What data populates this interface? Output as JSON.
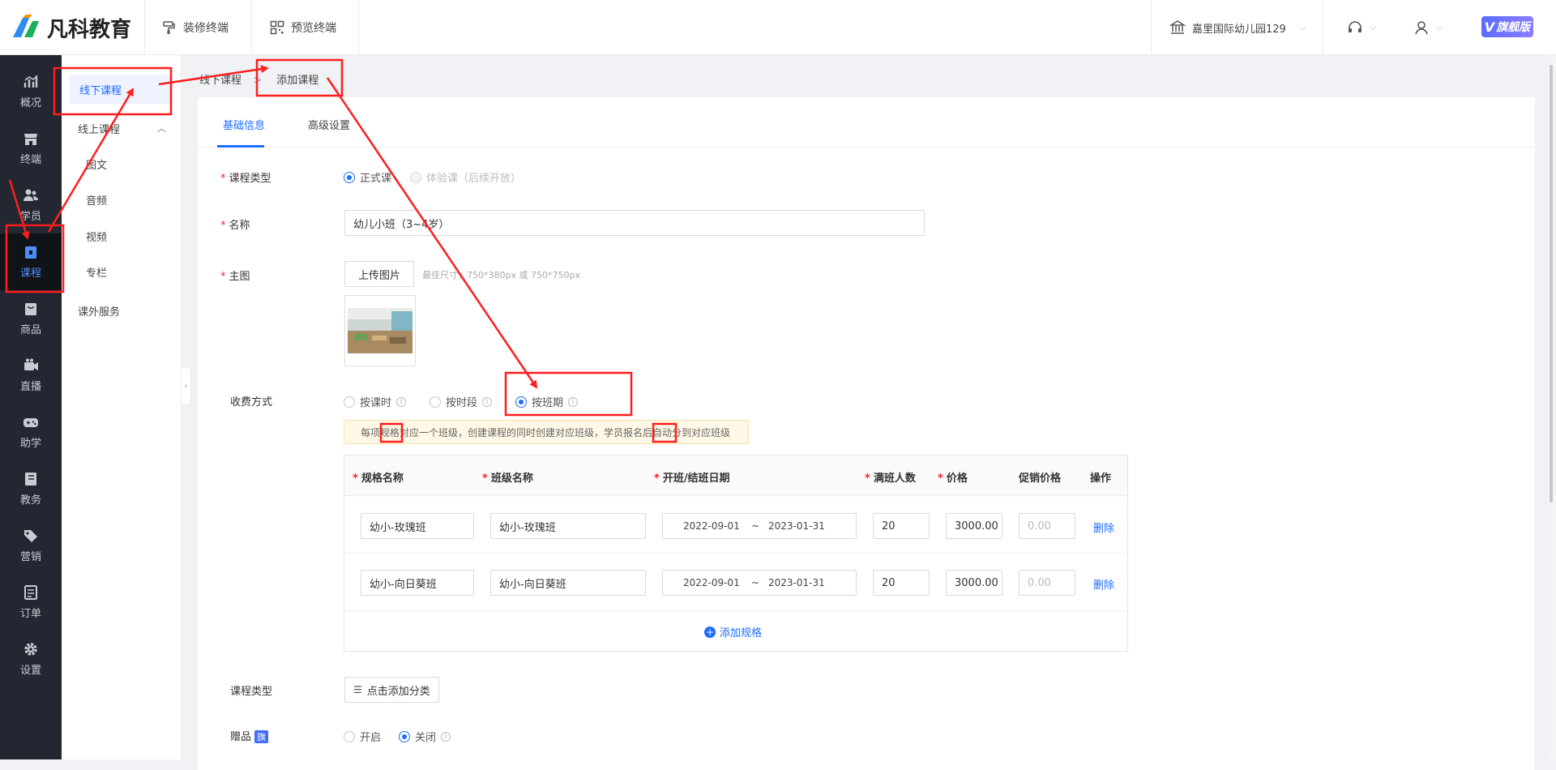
{
  "brand": {
    "name": "凡科教育"
  },
  "topbar": {
    "decorate": "装修终端",
    "preview": "预览终端",
    "school": "嘉里国际幼儿园129",
    "edition": "旗舰版"
  },
  "sidebar": {
    "items": [
      {
        "label": "概况",
        "icon": "chart-icon"
      },
      {
        "label": "终端",
        "icon": "store-icon"
      },
      {
        "label": "学员",
        "icon": "users-icon"
      },
      {
        "label": "课程",
        "icon": "book-icon",
        "active": true
      },
      {
        "label": "商品",
        "icon": "bag-icon"
      },
      {
        "label": "直播",
        "icon": "video-icon"
      },
      {
        "label": "助学",
        "icon": "gamepad-icon"
      },
      {
        "label": "教务",
        "icon": "notebook-icon"
      },
      {
        "label": "营销",
        "icon": "tag-icon"
      },
      {
        "label": "订单",
        "icon": "order-icon"
      },
      {
        "label": "设置",
        "icon": "gear-icon"
      }
    ]
  },
  "subnav": {
    "offline": "线下课程",
    "online": "线上课程",
    "text": "图文",
    "audio": "音频",
    "video": "视频",
    "column": "专栏",
    "extra": "课外服务"
  },
  "breadcrumb": {
    "parent": "线下课程",
    "sep": ">",
    "current": "添加课程"
  },
  "tabs": {
    "basic": "基础信息",
    "advanced": "高级设置"
  },
  "form": {
    "course_type_label": "课程类型",
    "type_formal": "正式课",
    "type_trial": "体验课（后续开放）",
    "name_label": "名称",
    "name_value": "幼儿小班（3~4岁）",
    "image_label": "主图",
    "upload_btn": "上传图片",
    "image_hint": "最佳尺寸：750*380px 或 750*750px",
    "fee_label": "收费方式",
    "fee_hour": "按课时",
    "fee_period": "按时段",
    "fee_class": "按班期",
    "notice": "每项规格对应一个班级，创建课程的同时创建对应班级，学员报名后自动分到对应班级",
    "category_label": "课程类型",
    "category_btn": "点击添加分类",
    "gift_label": "赠品",
    "gift_flag": "旗",
    "gift_on": "开启",
    "gift_off": "关闭"
  },
  "spec_table": {
    "headers": {
      "spec": "规格名称",
      "class": "班级名称",
      "dates": "开班/结班日期",
      "capacity": "满班人数",
      "price": "价格",
      "promo": "促销价格",
      "op": "操作"
    },
    "rows": [
      {
        "spec": "幼小-玫瑰班",
        "class": "幼小-玫瑰班",
        "start": "2022-09-01",
        "tilde": "~",
        "end": "2023-01-31",
        "capacity": "20",
        "price": "3000.00",
        "promo_placeholder": "0.00",
        "delete": "删除"
      },
      {
        "spec": "幼小-向日葵班",
        "class": "幼小-向日葵班",
        "start": "2022-09-01",
        "tilde": "~",
        "end": "2023-01-31",
        "capacity": "20",
        "price": "3000.00",
        "promo_placeholder": "0.00",
        "delete": "删除"
      }
    ],
    "add": "添加规格"
  },
  "colors": {
    "accent": "#1c6cff",
    "sidebar": "#232731",
    "annotation": "#ff1e1e"
  }
}
